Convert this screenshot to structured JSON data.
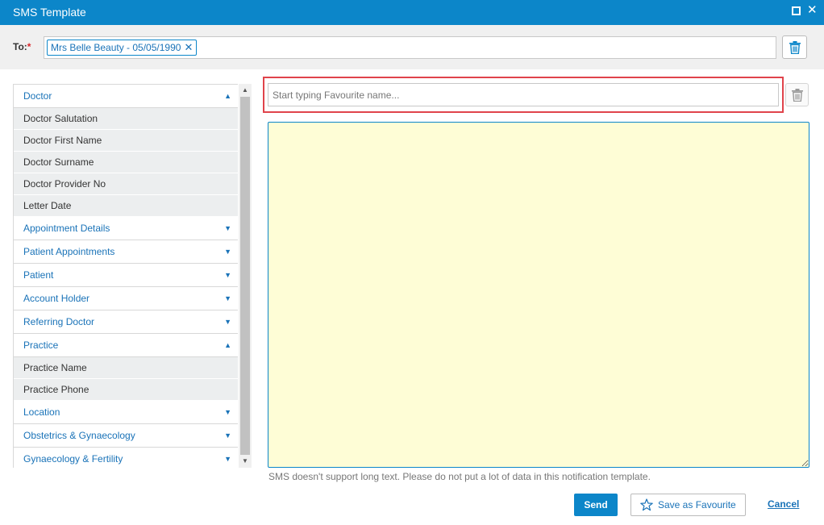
{
  "window": {
    "title": "SMS Template"
  },
  "to": {
    "label": "To:",
    "required_mark": "*",
    "recipient": "Mrs Belle Beauty - 05/05/1990",
    "remove_glyph": "✕"
  },
  "merge_fields": {
    "groups": [
      {
        "label": "Doctor",
        "expanded": true,
        "items": [
          "Doctor Salutation",
          "Doctor First Name",
          "Doctor Surname",
          "Doctor Provider No",
          "Letter Date"
        ]
      },
      {
        "label": "Appointment Details",
        "expanded": false,
        "items": []
      },
      {
        "label": "Patient Appointments",
        "expanded": false,
        "items": []
      },
      {
        "label": "Patient",
        "expanded": false,
        "items": []
      },
      {
        "label": "Account Holder",
        "expanded": false,
        "items": []
      },
      {
        "label": "Referring Doctor",
        "expanded": false,
        "items": []
      },
      {
        "label": "Practice",
        "expanded": true,
        "items": [
          "Practice Name",
          "Practice Phone"
        ]
      },
      {
        "label": "Location",
        "expanded": false,
        "items": []
      },
      {
        "label": "Obstetrics & Gynaecology",
        "expanded": false,
        "items": []
      },
      {
        "label": "Gynaecology & Fertility",
        "expanded": false,
        "items": []
      }
    ]
  },
  "favourite": {
    "placeholder": "Start typing Favourite name...",
    "value": ""
  },
  "message": {
    "value": "",
    "hint": "SMS doesn't support long text. Please do not put a lot of data in this notification template."
  },
  "actions": {
    "send_label": "Send",
    "save_favourite_label": "Save as Favourite",
    "cancel_label": "Cancel"
  },
  "colors": {
    "accent": "#0c86c9",
    "message_background": "#fefdd6",
    "highlight": "#e0434b"
  },
  "icons": {
    "maximize": "maximize-icon",
    "close": "close-icon",
    "trash": "trash-icon",
    "star": "star-icon",
    "expand": "chevron-up-icon",
    "collapse": "chevron-down-icon"
  }
}
